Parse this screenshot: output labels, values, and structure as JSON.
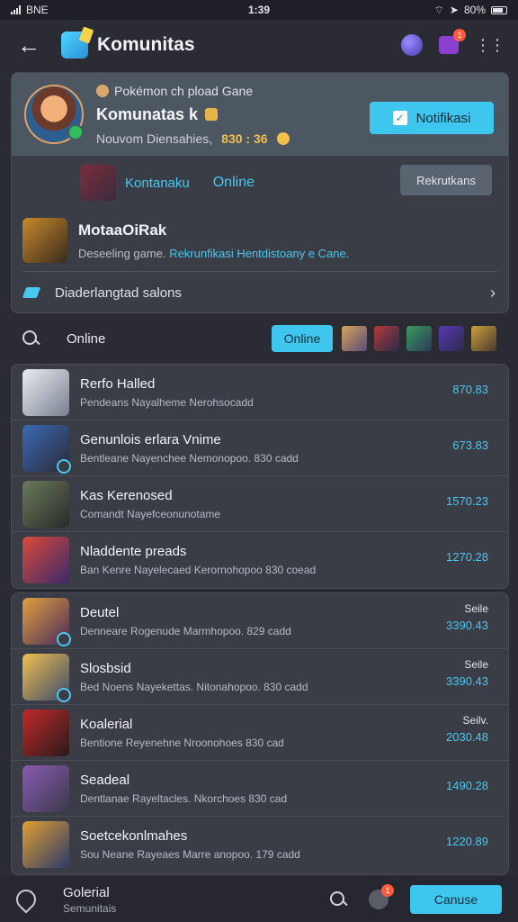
{
  "status": {
    "left": "BNE",
    "center": "1:39",
    "right": "80%"
  },
  "header": {
    "title": "Komunitas"
  },
  "chat_badge": "1",
  "profile": {
    "sub": "Pokémon ch pload Gane",
    "name": "Komunatas k",
    "stats_label": "Nouvom Diensahies,",
    "stats_value": "830 : 36",
    "notify_label": "Notifikasi"
  },
  "friend": {
    "name": "Kontanaku",
    "status": "Online",
    "action_label": "Rekrutkans"
  },
  "game": {
    "title": "MotaaOiRak",
    "desc_plain": "Deseeling game.",
    "desc_highlight": "Rekrunfikasi Hentdistoany e Cane."
  },
  "discover": {
    "label": "Diaderlangtad salons"
  },
  "filter": {
    "label": "Online",
    "pill": "Online"
  },
  "list1": [
    {
      "title": "Rerfo Halled",
      "sub": "Pendeans Nayalheme Nerohsocadd",
      "value": "870.83"
    },
    {
      "title": "Genunlois erlara Vnime",
      "sub": "Bentleane Nayenchee Nemonopoo. 830 cadd",
      "value": "673.83"
    },
    {
      "title": "Kas Kerenosed",
      "sub": "Comandt Nayefceonunotame",
      "value": "1570.23"
    },
    {
      "title": "Nladdente preads",
      "sub": "Ban Kenre Nayelecaed Kerornohopoo 830 coead",
      "value": "1270.28"
    }
  ],
  "list2": [
    {
      "title": "Deutel",
      "sub": "Denneare Rogenude Marmhopoo. 829 cadd",
      "tag": "Seile",
      "value": "3390.43"
    },
    {
      "title": "Slosbsid",
      "sub": "Bed Noens Nayekettas. Nitonahopoo. 830 cadd",
      "tag": "Seile",
      "value": "3390.43"
    },
    {
      "title": "Koalerial",
      "sub": "Bentione Reyenehne Nroonohoes 830 cad",
      "tag": "Seilv.",
      "value": "2030.48"
    },
    {
      "title": "Seadeal",
      "sub": "Dentlanae Rayeltacles. Nkorchoes 830 cad",
      "value": "1490.28"
    },
    {
      "title": "Soetcekonlmahes",
      "sub": "Sou Neane Rayeaes Marre anopoo. 179 cadd",
      "value": "1220.89"
    }
  ],
  "bottom": {
    "title": "Golerial",
    "sub": "Semunitais",
    "badge": "1",
    "button": "Canuse"
  }
}
